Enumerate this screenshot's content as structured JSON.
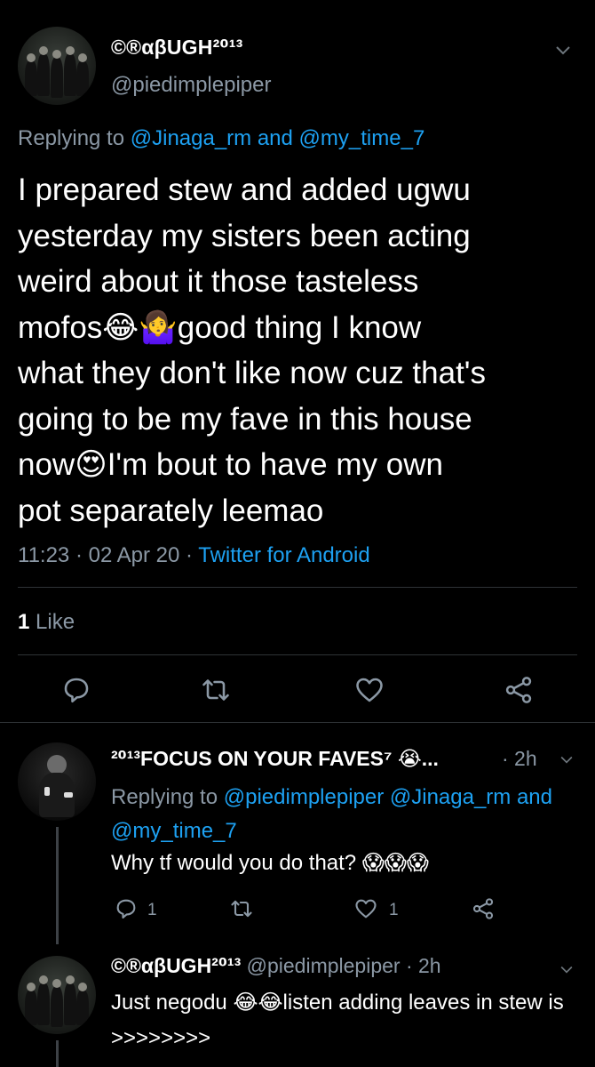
{
  "main_tweet": {
    "display_name": "©®αβUGH²⁰¹³",
    "handle": "@piedimplepiper",
    "replying_prefix": "Replying to",
    "replying_to": "@Jinaga_rm and @my_time_7",
    "text_lines": [
      "I prepared stew and added ugwu",
      "yesterday my sisters been acting",
      "weird about it those tasteless",
      "mofos😂🤷‍♀️good thing I know",
      "what they don't like now cuz that's",
      "going to be my fave in this house",
      "now😍I'm bout to have my own",
      "pot separately leemao"
    ],
    "time": "11:23",
    "date": "02 Apr 20",
    "source": "Twitter for Android",
    "likes_count": "1",
    "likes_label": "Like"
  },
  "reply_1": {
    "display_name": "²⁰¹³FOCUS ON YOUR FAVES⁷ 😭...",
    "time": "· 2h",
    "replying_prefix": "Replying to",
    "replying_to": "@piedimplepiper @Jinaga_rm and @my_time_7",
    "text": "Why tf would you do that? 😱😱😱",
    "reply_count": "1",
    "like_count": "1"
  },
  "reply_2": {
    "display_name": "©®αβUGH²⁰¹³",
    "handle": "@piedimplepiper",
    "time": "· 2h",
    "text": "Just negodu 😂😂listen adding leaves in stew is >>>>>>>>"
  },
  "icons": {
    "reply": "reply-icon",
    "retweet": "retweet-icon",
    "like": "heart-icon",
    "share": "share-icon",
    "caret": "chevron-down-icon"
  },
  "colors": {
    "background": "#000000",
    "text": "#ffffff",
    "muted": "#8b98a5",
    "link": "#1da1f2",
    "divider": "#2f3336"
  }
}
